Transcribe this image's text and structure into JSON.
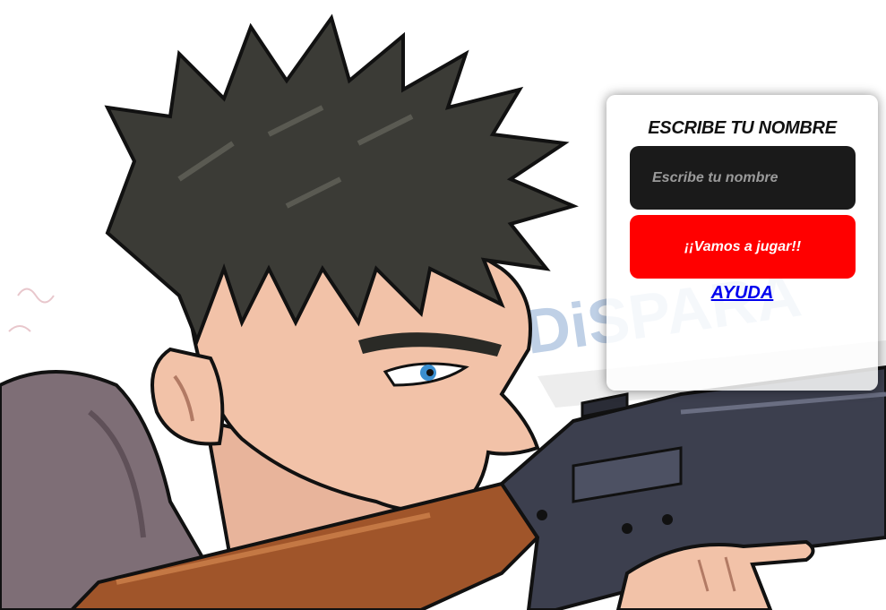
{
  "background": {
    "description_icon": "soldier-aiming-rifle-illustration",
    "colors": {
      "hair": "#3b3b36",
      "skin": "#f2c2a8",
      "hoodie": "#7e6e76",
      "rifle_wood": "#a0552a",
      "rifle_metal": "#3c3f4e",
      "eye": "#3b8fd0"
    }
  },
  "login_card": {
    "title": "ESCRIBE TU NOMBRE",
    "name_input": {
      "placeholder": "Escribe tu nombre",
      "value": ""
    },
    "play_button_label": "¡¡Vamos a jugar!!",
    "help_link_label": "AYUDA",
    "colors": {
      "input_bg": "#1a1a1a",
      "button_bg": "#ff0000",
      "link": "#0000ee"
    }
  }
}
